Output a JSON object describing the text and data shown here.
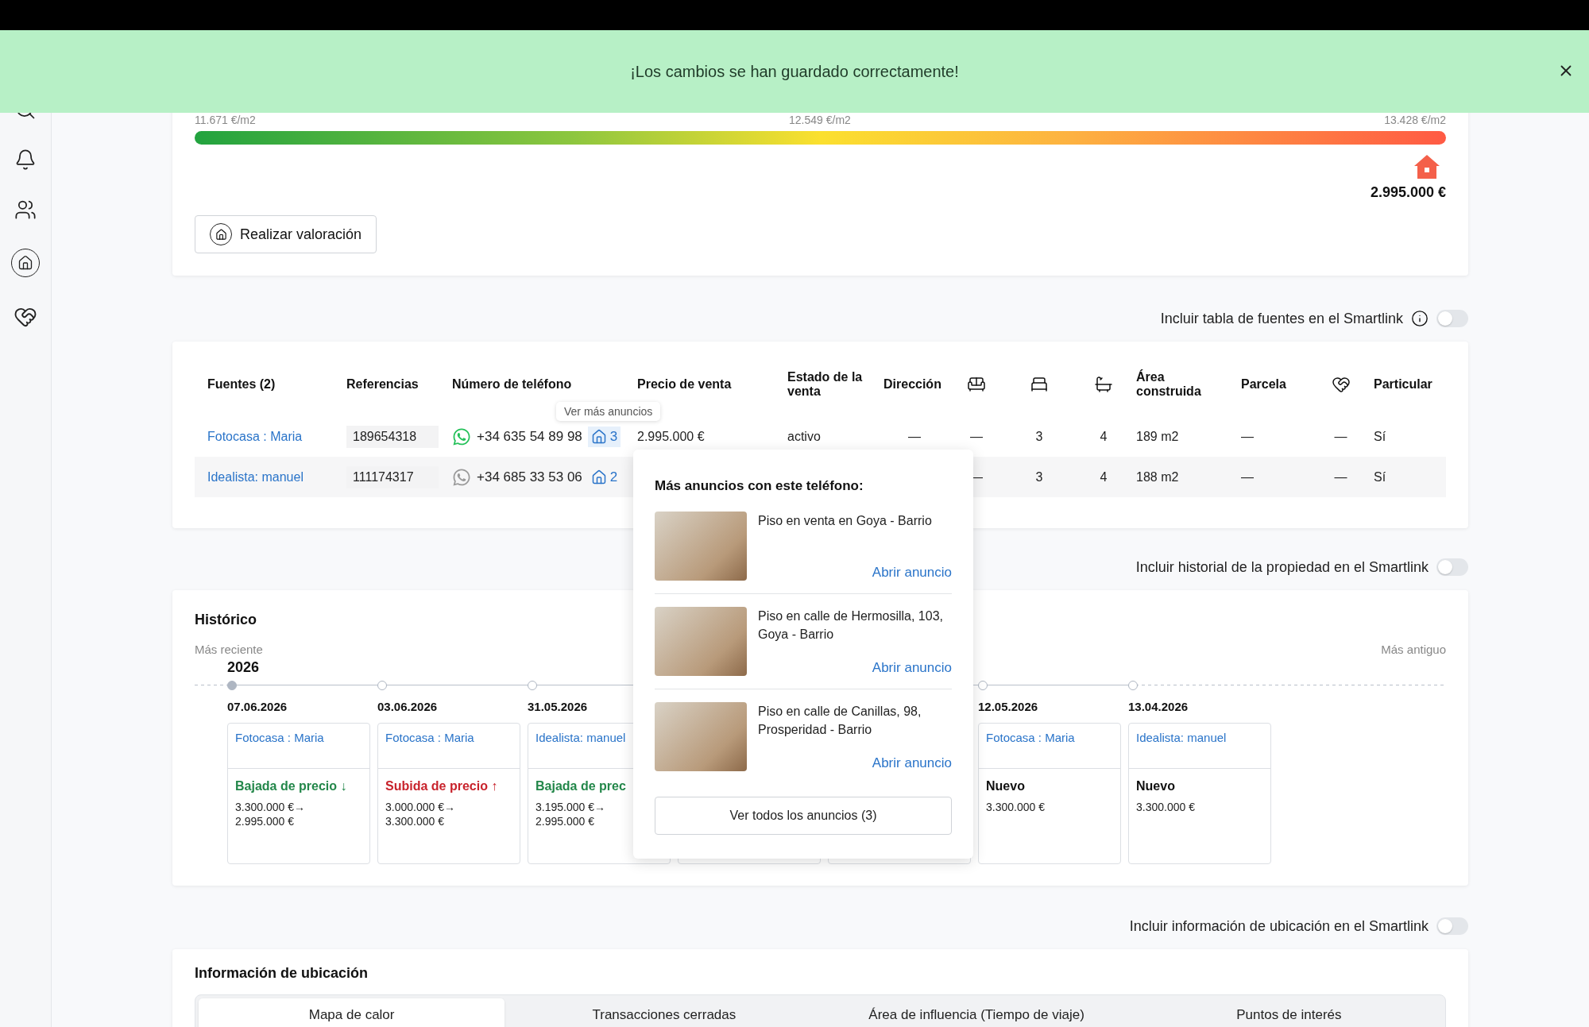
{
  "toast": {
    "message": "¡Los cambios se han guardado correctamente!"
  },
  "valuation": {
    "price_labels": [
      "11.671 €/m2",
      "12.549 €/m2",
      "13.428 €/m2"
    ],
    "level": 0.985,
    "price": "2.995.000 €",
    "button": "Realizar valoración"
  },
  "sources_toggle": {
    "label": "Incluir tabla de fuentes en el Smartlink",
    "on": false
  },
  "sources_table": {
    "columns": [
      {
        "label": "Fuentes (2)",
        "kind": "text"
      },
      {
        "label": "Referencias",
        "kind": "text"
      },
      {
        "label": "Número de teléfono",
        "kind": "text"
      },
      {
        "label": "Precio de venta",
        "kind": "text"
      },
      {
        "label": "Estado de la venta",
        "kind": "text"
      },
      {
        "label": "Dirección",
        "kind": "text"
      },
      {
        "kind": "icon"
      },
      {
        "kind": "icon"
      },
      {
        "kind": "icon"
      },
      {
        "label": "Área construida",
        "kind": "text"
      },
      {
        "label": "Parcela",
        "kind": "text"
      },
      {
        "kind": "icon"
      },
      {
        "label": "Particular",
        "kind": "text"
      }
    ],
    "rows": [
      {
        "cells": [
          {
            "kind": "link",
            "text": "Fotocasa : Maria"
          },
          {
            "kind": "reference",
            "text": "189654318"
          },
          {
            "kind": "phone",
            "text": "+34 635 54 89 98",
            "whatsapp": true,
            "listings": "3",
            "highlighted": true
          },
          "2.995.000 €",
          "activo",
          "—",
          "—",
          "3",
          "4",
          "189 m2",
          "—",
          "—",
          "Sí"
        ]
      },
      {
        "cells": [
          {
            "kind": "link",
            "text": "Idealista: manuel"
          },
          {
            "kind": "reference",
            "text": "111174317"
          },
          {
            "kind": "phone",
            "text": "+34 685 33 53 06",
            "whatsapp": false,
            "listings": "2",
            "highlighted": false
          },
          "",
          "",
          "",
          "—",
          "3",
          "4",
          "188 m2",
          "—",
          "—",
          "Sí"
        ]
      }
    ]
  },
  "tooltip": {
    "text": "Ver más anuncios"
  },
  "popup": {
    "title": "Más anuncios con este teléfono:",
    "listings": [
      {
        "title": "Piso en venta en Goya - Barrio",
        "link": "Abrir anuncio"
      },
      {
        "title": "Piso en calle de Hermosilla, 103, Goya - Barrio",
        "link": "Abrir anuncio"
      },
      {
        "title": "Piso en calle de Canillas, 98, Prosperidad - Barrio",
        "link": "Abrir anuncio"
      }
    ],
    "button": "Ver todos los anuncios (3)"
  },
  "history_toggle": {
    "label": "Incluir historial de la propiedad en el Smartlink",
    "on": false
  },
  "history": {
    "title": "Histórico",
    "newest_label": "Más reciente",
    "oldest_label": "Más antiguo",
    "year": "2026",
    "events": [
      {
        "selected": true,
        "date": "07.06.2026",
        "source": "Fotocasa : Maria",
        "kind": "down",
        "change": "Bajada de precio ↓",
        "prices": [
          "3.300.000 €→",
          "2.995.000 €"
        ]
      },
      {
        "selected": false,
        "date": "03.06.2026",
        "source": "Fotocasa : Maria",
        "kind": "up",
        "change": "Subida de precio ↑",
        "prices": [
          "3.000.000 €→",
          "3.300.000 €"
        ]
      },
      {
        "selected": false,
        "date": "31.05.2026",
        "source": "Idealista: manuel",
        "kind": "down",
        "change": "Bajada de prec",
        "prices": [
          "3.195.000 €→",
          "2.995.000 €"
        ]
      },
      {
        "kind": "covered"
      },
      {
        "kind": "covered"
      },
      {
        "selected": false,
        "date": "12.05.2026",
        "source": "Fotocasa : Maria",
        "kind": "new",
        "change": "Nuevo",
        "prices": [
          "3.300.000 €"
        ]
      },
      {
        "selected": false,
        "date": "13.04.2026",
        "source": "Idealista: manuel",
        "kind": "new",
        "change": "Nuevo",
        "prices": [
          "3.300.000 €"
        ]
      }
    ]
  },
  "location_toggle": {
    "label": "Incluir información de ubicación en el Smartlink",
    "on": false
  },
  "location": {
    "title": "Información de ubicación",
    "tabs": [
      {
        "label": "Mapa de calor",
        "selected": true
      },
      {
        "label": "Transacciones cerradas",
        "selected": false
      },
      {
        "label": "Área de influencia (Tiempo de viaje)",
        "selected": false
      },
      {
        "label": "Puntos de interés",
        "selected": false
      }
    ]
  }
}
